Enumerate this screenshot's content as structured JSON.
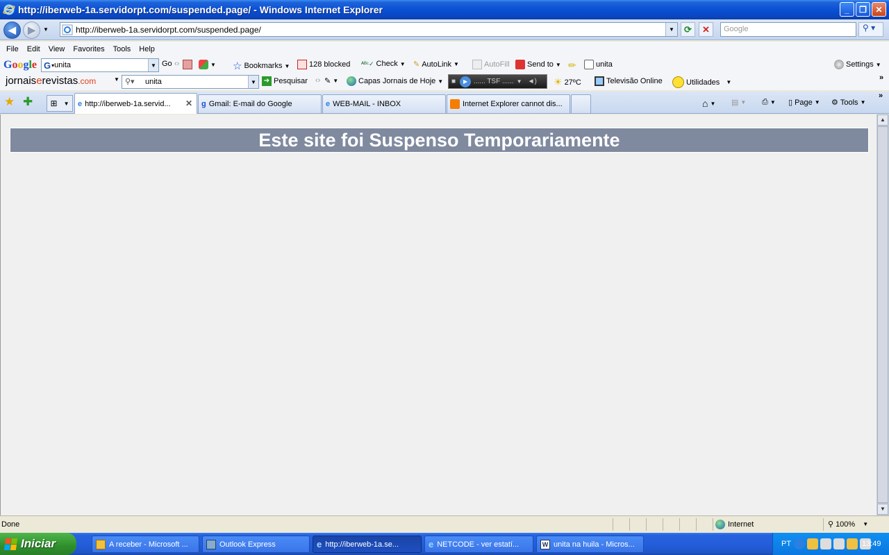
{
  "window": {
    "title": "http://iberweb-1a.servidorpt.com/suspended.page/ - Windows Internet Explorer",
    "minimize": "_",
    "restore": "❐",
    "close": "✕"
  },
  "navigation": {
    "address": "http://iberweb-1a.servidorpt.com/suspended.page/",
    "search_placeholder": "Google"
  },
  "menu": [
    "File",
    "Edit",
    "View",
    "Favorites",
    "Tools",
    "Help"
  ],
  "google_toolbar": {
    "logo": "Google",
    "search_value": "unita",
    "go": "Go",
    "bookmarks": "Bookmarks",
    "blocked": "128 blocked",
    "check": "Check",
    "autolink": "AutoLink",
    "autofill": "AutoFill",
    "send_to": "Send to",
    "highlight_term": "unita",
    "settings": "Settings"
  },
  "jornais_toolbar": {
    "logo_part1": "jornais",
    "logo_part2": "e",
    "logo_part3": "revistas",
    "logo_part4": ".com",
    "search_value": "unita",
    "pesquisar": "Pesquisar",
    "capas": "Capas Jornais de Hoje",
    "radio": "...... TSF ......",
    "temperature": "27ºC",
    "televisao": "Televisão Online",
    "utilidades": "Utilidades"
  },
  "tabs": [
    {
      "label": "http://iberweb-1a.servid...",
      "active": true
    },
    {
      "label": "Gmail: E-mail do Google",
      "active": false
    },
    {
      "label": "WEB-MAIL - INBOX",
      "active": false
    },
    {
      "label": "Internet Explorer cannot dis...",
      "active": false
    }
  ],
  "command_bar": {
    "page": "Page",
    "tools": "Tools"
  },
  "page": {
    "banner": "Este site foi Suspenso Temporariamente"
  },
  "status": {
    "text": "Done",
    "zone": "Internet",
    "zoom": "100%"
  },
  "taskbar": {
    "start": "Iniciar",
    "buttons": [
      {
        "label": "A receber - Microsoft ...",
        "active": false
      },
      {
        "label": "Outlook Express",
        "active": false
      },
      {
        "label": "http://iberweb-1a.se...",
        "active": true
      },
      {
        "label": "NETCODE - ver estatí...",
        "active": false
      },
      {
        "label": "unita na huila - Micros...",
        "active": false
      }
    ],
    "language": "PT",
    "time": "13:49"
  },
  "colors": {
    "banner_bg": "#7f8a9f",
    "page_bg": "#f0f0f0",
    "title_blue": "#0a50d4",
    "start_green": "#3a9a37"
  }
}
